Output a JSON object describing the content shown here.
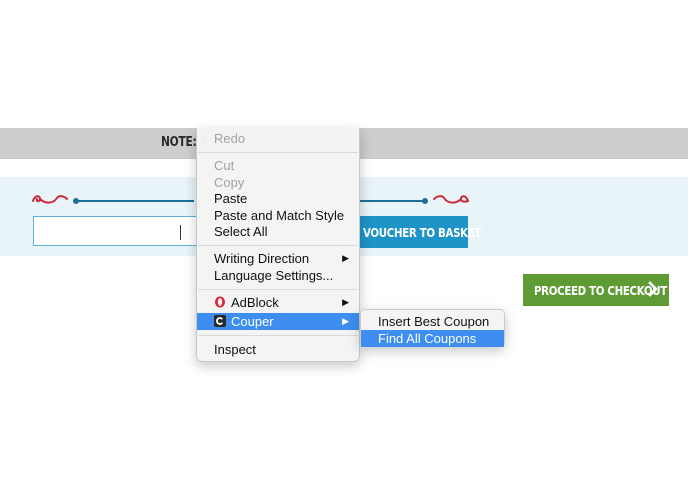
{
  "note": {
    "text": "NOTE: T"
  },
  "voucher": {
    "input_value": "",
    "button_label": "VOUCHER TO BASKET"
  },
  "checkout": {
    "button_label": "PROCEED TO CHECKOUT"
  },
  "context_menu": {
    "items": [
      {
        "label": "Redo",
        "disabled": true
      },
      {
        "label": "Cut",
        "disabled": true
      },
      {
        "label": "Copy",
        "disabled": true
      },
      {
        "label": "Paste"
      },
      {
        "label": "Paste and Match Style"
      },
      {
        "label": "Select All"
      },
      {
        "label": "Writing Direction"
      },
      {
        "label": "Language Settings..."
      },
      {
        "label": "AdBlock"
      },
      {
        "label": "Couper"
      },
      {
        "label": "Inspect"
      }
    ]
  },
  "submenu": {
    "items": [
      {
        "label": "Insert Best Coupon"
      },
      {
        "label": "Find All Coupons"
      }
    ]
  },
  "colors": {
    "accent": "#3d8ef0",
    "voucher_button": "#1e93c7",
    "checkout_button": "#5f9b35",
    "divider": "#1f6e95",
    "swirl": "#cc2a3a"
  },
  "icons": {
    "adblock": "opera-o-icon",
    "couper": "couper-c-icon",
    "submenu_arrow": "chevron-right-icon",
    "checkout_chevron": "chevron-right-icon"
  }
}
